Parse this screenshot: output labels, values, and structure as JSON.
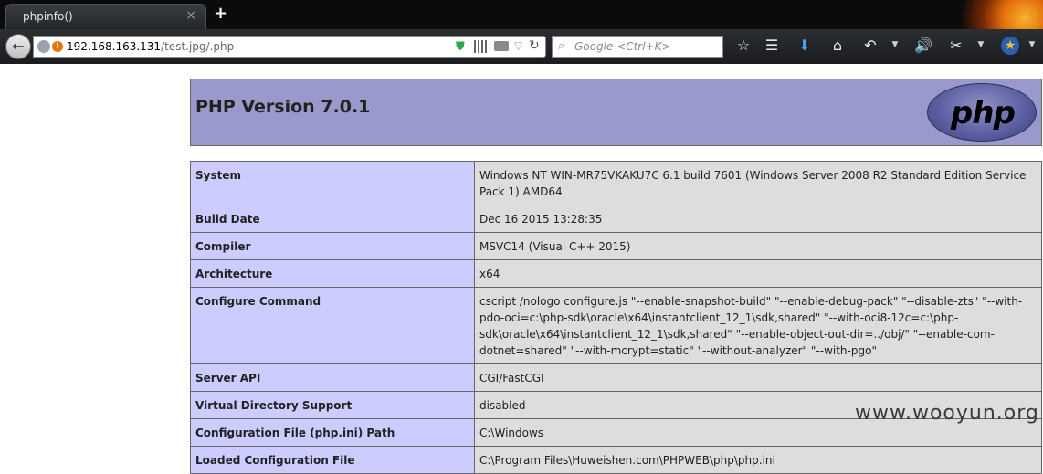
{
  "browser": {
    "tab_title": "phpinfo()",
    "tab_close": "×",
    "new_tab": "+",
    "url_host": "192.168.163.131",
    "url_path": "/test.jpg/.php",
    "search_placeholder": "Google <Ctrl+K>"
  },
  "header": {
    "title": "PHP Version 7.0.1",
    "logo_text": "php"
  },
  "rows": [
    {
      "label": "System",
      "value": "Windows NT WIN-MR75VKAKU7C 6.1 build 7601 (Windows Server 2008 R2 Standard Edition Service Pack 1) AMD64"
    },
    {
      "label": "Build Date",
      "value": "Dec 16 2015 13:28:35"
    },
    {
      "label": "Compiler",
      "value": "MSVC14 (Visual C++ 2015)"
    },
    {
      "label": "Architecture",
      "value": "x64"
    },
    {
      "label": "Configure Command",
      "value": "cscript /nologo configure.js \"--enable-snapshot-build\" \"--enable-debug-pack\" \"--disable-zts\" \"--with-pdo-oci=c:\\php-sdk\\oracle\\x64\\instantclient_12_1\\sdk,shared\" \"--with-oci8-12c=c:\\php-sdk\\oracle\\x64\\instantclient_12_1\\sdk,shared\" \"--enable-object-out-dir=../obj/\" \"--enable-com-dotnet=shared\" \"--with-mcrypt=static\" \"--without-analyzer\" \"--with-pgo\""
    },
    {
      "label": "Server API",
      "value": "CGI/FastCGI"
    },
    {
      "label": "Virtual Directory Support",
      "value": "disabled"
    },
    {
      "label": "Configuration File (php.ini) Path",
      "value": "C:\\Windows"
    },
    {
      "label": "Loaded Configuration File",
      "value": "C:\\Program Files\\Huweishen.com\\PHPWEB\\php\\php.ini"
    }
  ],
  "watermark": "www.wooyun.org",
  "colors": {
    "header_bg": "#9999cc",
    "label_bg": "#ccccff",
    "value_bg": "#dddddd"
  }
}
